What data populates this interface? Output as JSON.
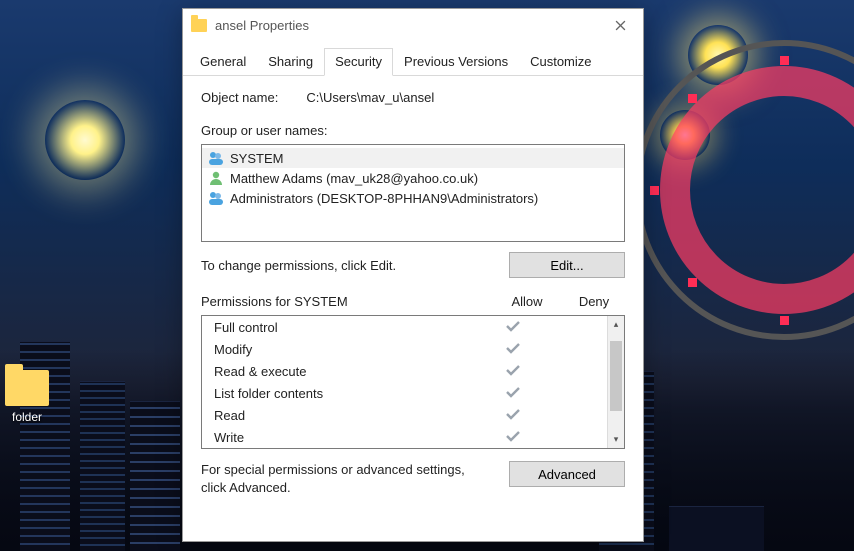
{
  "window": {
    "title": "ansel Properties"
  },
  "tabs": {
    "general": "General",
    "sharing": "Sharing",
    "security": "Security",
    "previous": "Previous Versions",
    "customize": "Customize"
  },
  "security": {
    "object_label": "Object name:",
    "object_path": "C:\\Users\\mav_u\\ansel",
    "group_label": "Group or user names:",
    "users": [
      {
        "name": "SYSTEM",
        "type": "group"
      },
      {
        "name": "Matthew Adams (mav_uk28@yahoo.co.uk)",
        "type": "user"
      },
      {
        "name": "Administrators (DESKTOP-8PHHAN9\\Administrators)",
        "type": "group"
      }
    ],
    "change_hint": "To change permissions, click Edit.",
    "edit_btn": "Edit...",
    "perm_header_name": "Permissions for SYSTEM",
    "perm_header_allow": "Allow",
    "perm_header_deny": "Deny",
    "permissions": [
      {
        "name": "Full control",
        "allow": true,
        "deny": false
      },
      {
        "name": "Modify",
        "allow": true,
        "deny": false
      },
      {
        "name": "Read & execute",
        "allow": true,
        "deny": false
      },
      {
        "name": "List folder contents",
        "allow": true,
        "deny": false
      },
      {
        "name": "Read",
        "allow": true,
        "deny": false
      },
      {
        "name": "Write",
        "allow": true,
        "deny": false
      }
    ],
    "advanced_hint": "For special permissions or advanced settings, click Advanced.",
    "advanced_btn": "Advanced"
  },
  "desktop": {
    "folder_label": "folder"
  }
}
